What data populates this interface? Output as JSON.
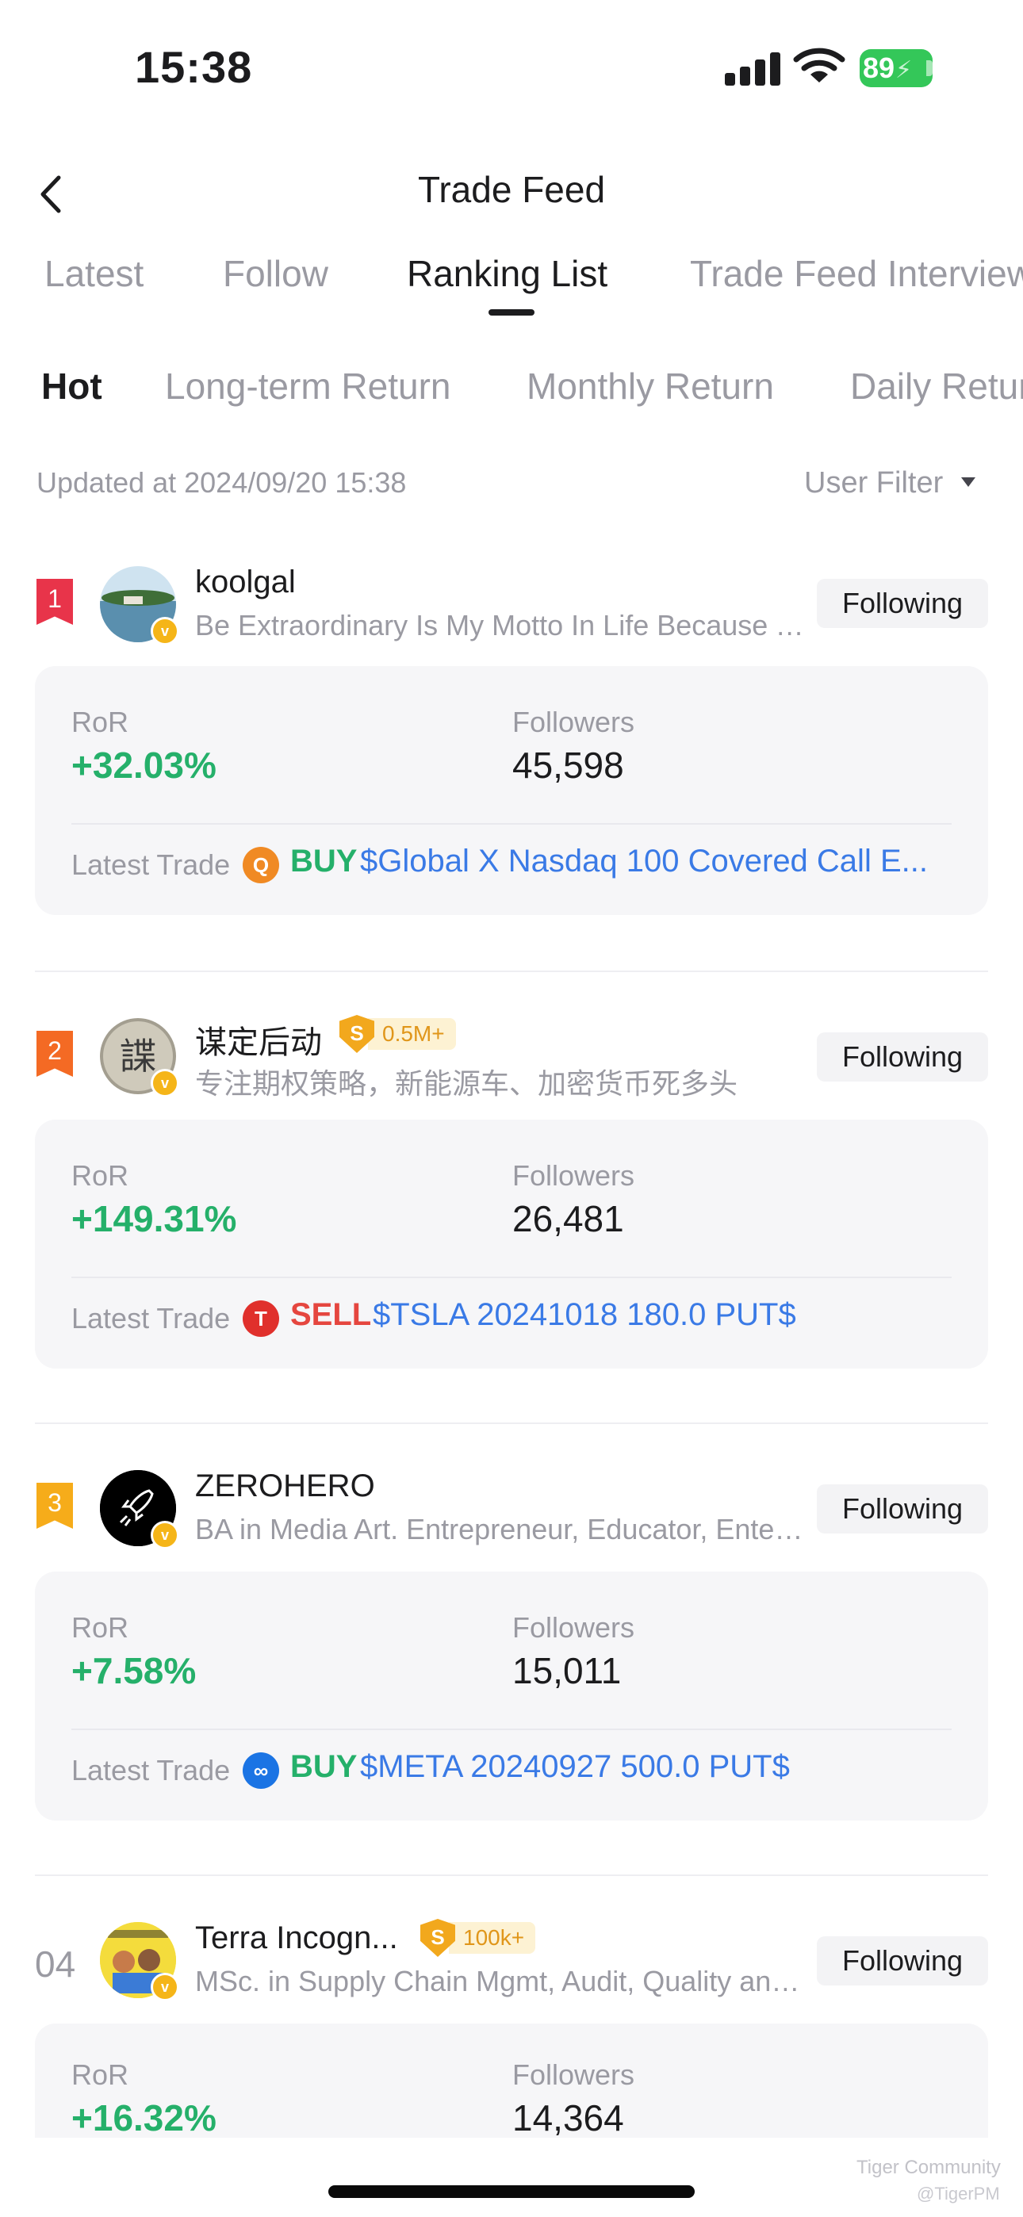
{
  "status_bar": {
    "time": "15:38",
    "battery": "89"
  },
  "header": {
    "title": "Trade Feed"
  },
  "tabs": [
    {
      "label": "Latest"
    },
    {
      "label": "Follow"
    },
    {
      "label": "Ranking List"
    },
    {
      "label": "Trade Feed Interview"
    }
  ],
  "subtabs": [
    {
      "label": "Hot"
    },
    {
      "label": "Long-term Return"
    },
    {
      "label": "Monthly Return"
    },
    {
      "label": "Daily Return"
    }
  ],
  "updated": "Updated at 2024/09/20 15:38",
  "filter_label": "User Filter",
  "labels": {
    "ror": "RoR",
    "followers": "Followers",
    "latest_trade": "Latest Trade",
    "following": "Following"
  },
  "traders": [
    {
      "rank": "1",
      "name": "koolgal",
      "bio": "Be Extraordinary Is My Motto In Life Because T...",
      "ror": "+32.03%",
      "followers": "45,598",
      "trade_icon": "Q",
      "trade_action": "BUY",
      "trade_symbol": "$Global X Nasdaq 100 Covered Call E..."
    },
    {
      "rank": "2",
      "name": "谋定后动",
      "level_badge": "0.5M+",
      "bio": "专注期权策略，新能源车、加密货币死多头",
      "ror": "+149.31%",
      "followers": "26,481",
      "trade_icon": "T",
      "trade_action": "SELL",
      "trade_symbol": "$TSLA 20241018 180.0 PUT$"
    },
    {
      "rank": "3",
      "name": "ZEROHERO",
      "bio": "BA in Media Art. Entrepreneur, Educator, Entert...",
      "ror": "+7.58%",
      "followers": "15,011",
      "trade_icon": "∞",
      "trade_action": "BUY",
      "trade_symbol": "$META 20240927 500.0 PUT$"
    },
    {
      "rank": "04",
      "name": "Terra Incogn...",
      "level_badge": "100k+",
      "bio": "MSc. in Supply Chain Mgmt, Audit, Quality and...",
      "ror": "+16.32%",
      "followers": "14,364"
    }
  ],
  "watermark": "Tiger Community",
  "watermark_handle": "@TigerPM",
  "colors": {
    "accent_green": "#25b06a",
    "sell_red": "#e5463f",
    "link_blue": "#3a7ae6",
    "rank1": "#e8344a",
    "rank2": "#f46a24",
    "rank3": "#f6ac1a",
    "battery": "#34c759"
  }
}
